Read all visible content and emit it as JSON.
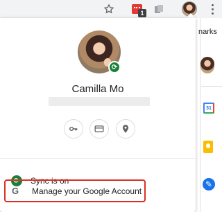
{
  "toolbar": {
    "bookmark_icon": "star-icon",
    "extension_badge": "1",
    "extension_icons": [
      "red-extension-icon",
      "gray-extension-icon"
    ],
    "menu_icon": "three-dot-menu-icon"
  },
  "background_page": {
    "partial_text": "narks",
    "apps": [
      "calendar-icon",
      "keep-icon",
      "tasks-icon"
    ],
    "calendar_day": "31"
  },
  "profile": {
    "name": "Camilla Mo",
    "avatar": "profile-avatar",
    "sync_badge_icon": "sync-icon"
  },
  "quick_actions": [
    {
      "name": "passwords-key-icon"
    },
    {
      "name": "payment-card-icon"
    },
    {
      "name": "addresses-pin-icon"
    }
  ],
  "menu": {
    "sync_label": "Sync is on",
    "manage_label": "Manage your Google Account"
  },
  "colors": {
    "sync_green": "#188038",
    "highlight_red": "#d93025",
    "google_blue": "#1a73e8"
  }
}
